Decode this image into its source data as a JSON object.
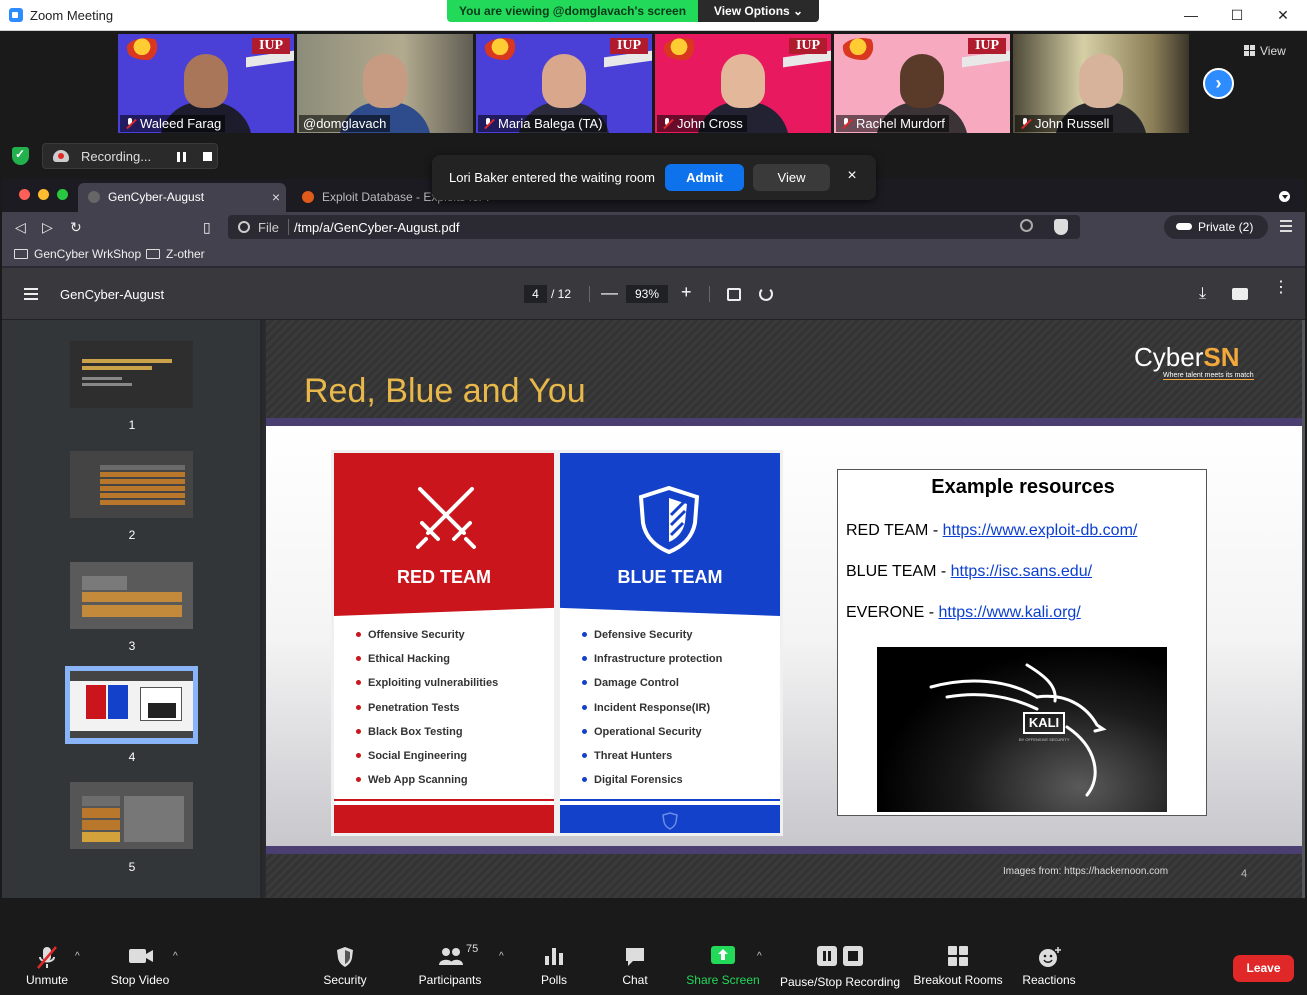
{
  "window": {
    "title": "Zoom Meeting"
  },
  "banner": {
    "viewing": "You are viewing @domglavach's screen",
    "view_options": "View Options ⌄"
  },
  "participants": [
    {
      "name": "Waleed Farag",
      "muted": true
    },
    {
      "name": "@domglavach",
      "muted": false
    },
    {
      "name": "Maria Balega (TA)",
      "muted": true
    },
    {
      "name": "John Cross",
      "muted": true
    },
    {
      "name": "Rachel Murdorf",
      "muted": true
    },
    {
      "name": "John Russell",
      "muted": true
    }
  ],
  "tile_logo": "IUP",
  "view_label": "View",
  "recording": {
    "label": "Recording..."
  },
  "waiting_room": {
    "message": "Lori Baker entered the waiting room",
    "admit": "Admit",
    "view": "View",
    "close": "×"
  },
  "browser": {
    "tabs": [
      {
        "label": "GenCyber-August"
      },
      {
        "label": "Exploit Database - Exploits for Pen"
      }
    ],
    "url_scheme": "File",
    "url": "/tmp/a/GenCyber-August.pdf",
    "private": "Private (2)",
    "bookmarks": [
      "GenCyber WrkShop",
      "Z-other"
    ]
  },
  "pdf": {
    "title": "GenCyber-August",
    "page": "4",
    "total": "/ 12",
    "zoom": "93%",
    "thumbs": [
      "1",
      "2",
      "3",
      "4",
      "5"
    ]
  },
  "slide": {
    "title": "Red, Blue and You",
    "brand_a": "Cyber",
    "brand_b": "SN",
    "tagline": "Where talent meets its match",
    "red_team": {
      "name": "RED TEAM",
      "items": [
        "Offensive Security",
        "Ethical Hacking",
        "Exploiting vulnerabilities",
        "Penetration Tests",
        "Black Box Testing",
        "Social Engineering",
        "Web App Scanning"
      ]
    },
    "blue_team": {
      "name": "BLUE TEAM",
      "items": [
        "Defensive Security",
        "Infrastructure protection",
        "Damage Control",
        "Incident Response(IR)",
        "Operational Security",
        "Threat Hunters",
        "Digital Forensics"
      ]
    },
    "resources": {
      "title": "Example resources",
      "rows": [
        {
          "label": "RED TEAM - ",
          "link": "https://www.exploit-db.com/"
        },
        {
          "label": "BLUE TEAM - ",
          "link": "https://isc.sans.edu/"
        },
        {
          "label": "EVERONE - ",
          "link": "https://www.kali.org/"
        }
      ],
      "kali": "KALI",
      "kali_sub": "BY OFFENSIVE SECURITY"
    },
    "credit": "Images from: https://hackernoon.com",
    "page_number": "4"
  },
  "controls": {
    "unmute": "Unmute",
    "stop_video": "Stop Video",
    "security": "Security",
    "participants": "Participants",
    "participant_count": "75",
    "polls": "Polls",
    "chat": "Chat",
    "share_screen": "Share Screen",
    "pause_recording": "Pause/Stop Recording",
    "breakout": "Breakout Rooms",
    "reactions": "Reactions",
    "leave": "Leave"
  },
  "colors": {
    "zoom_blue": "#2d8cff",
    "share_green": "#23d959",
    "leave_red": "#e02828",
    "slide_gold": "#e8b84a",
    "red_team": "#c9151b",
    "blue_team": "#1341c9"
  }
}
